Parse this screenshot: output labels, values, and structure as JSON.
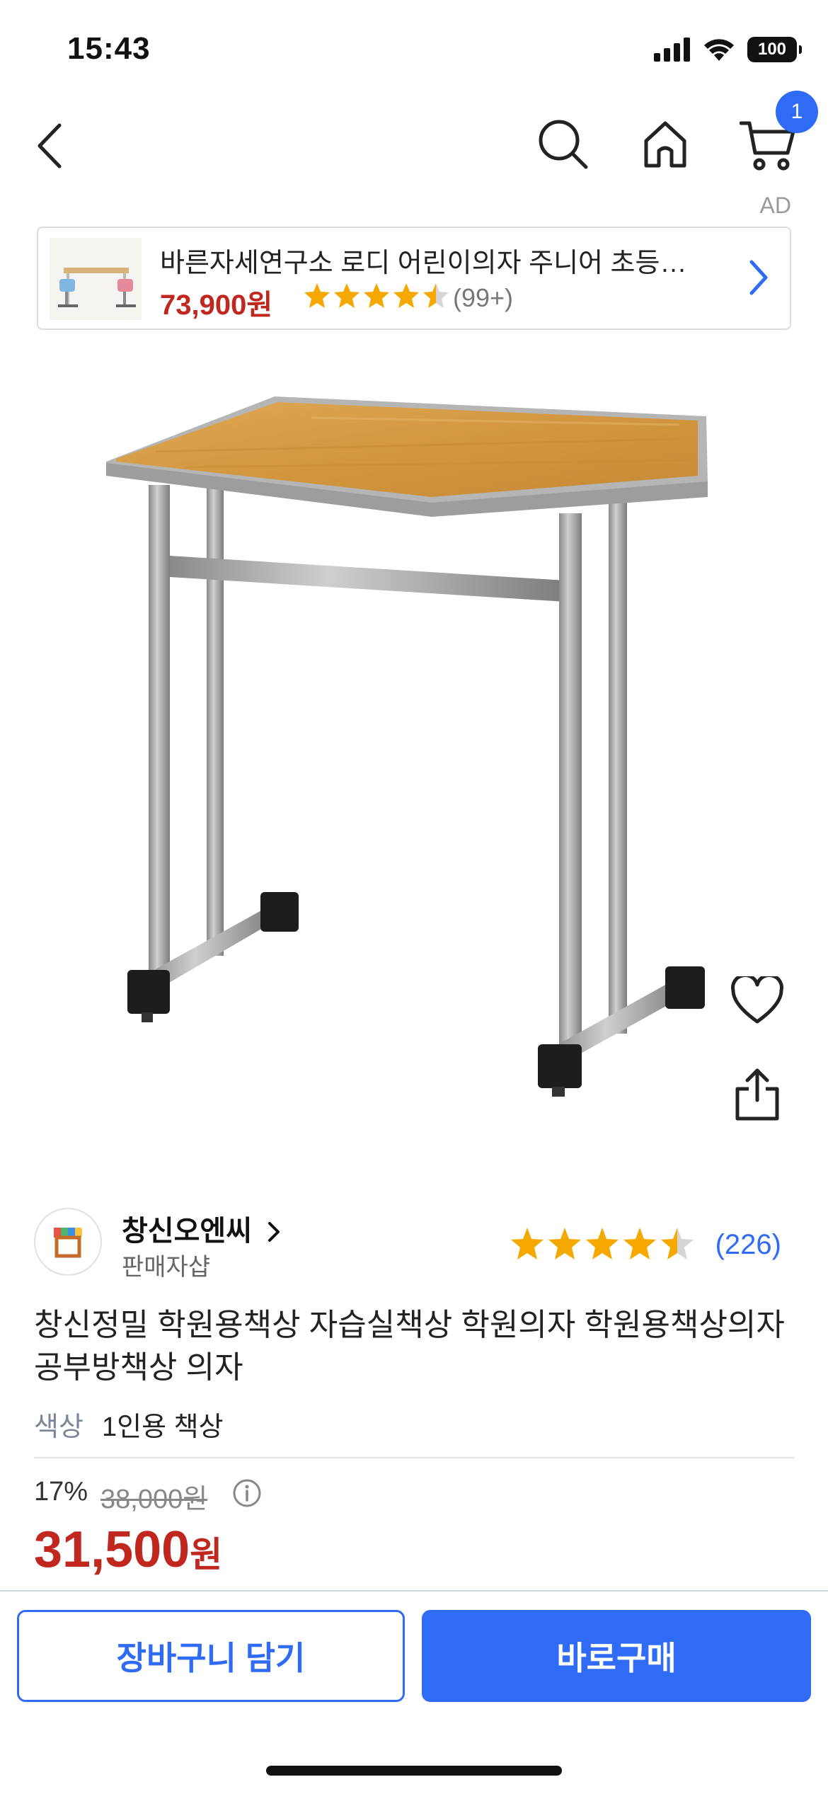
{
  "status_bar": {
    "time": "15:43",
    "battery": "100"
  },
  "nav": {
    "cart_badge": "1"
  },
  "ad": {
    "label": "AD",
    "title": "바른자세연구소 로디 어린이의자 주니어 초등…",
    "price": "73,900원",
    "review_count": "(99+)",
    "rating": 4.5
  },
  "seller": {
    "name": "창신오엔씨",
    "subtitle": "판매자샵",
    "rating": 4.5,
    "review_count": "(226)"
  },
  "product": {
    "title": "창신정밀 학원용책상 자습실책상 학원의자 학원용책상의자 공부방책상 의자",
    "option_label": "색상",
    "option_value": "1인용 책상",
    "discount": "17%",
    "original_price": "38,000원",
    "sale_price_number": "31,500",
    "sale_price_unit": "원"
  },
  "actions": {
    "add_to_cart": "장바구니 담기",
    "buy_now": "바로구매"
  },
  "colors": {
    "accent": "#2f6bf5",
    "price_red": "#c0271f",
    "star": "#f5a800"
  },
  "icons": [
    "back-icon",
    "search-icon",
    "home-icon",
    "cart-icon",
    "heart-icon",
    "share-icon",
    "info-icon",
    "chevron-right-icon"
  ]
}
